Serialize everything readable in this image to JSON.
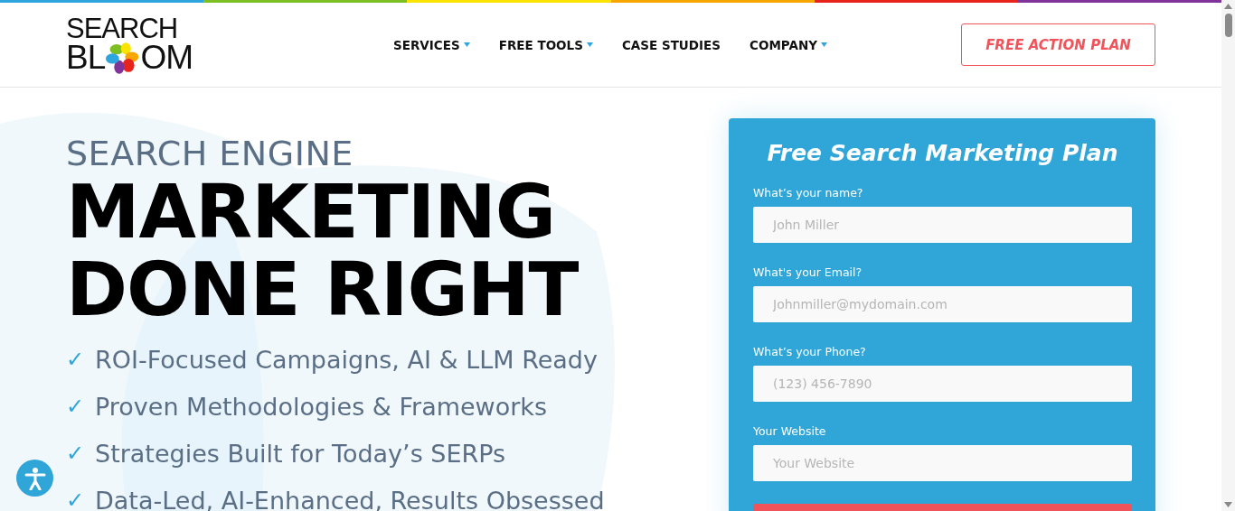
{
  "logo": {
    "top": "SEARCH",
    "bottom_left": "BL",
    "bottom_right": "OM"
  },
  "nav": [
    {
      "label": "SERVICES",
      "dropdown": true
    },
    {
      "label": "FREE TOOLS",
      "dropdown": true
    },
    {
      "label": "CASE STUDIES",
      "dropdown": false
    },
    {
      "label": "COMPANY",
      "dropdown": true
    }
  ],
  "cta_button": "FREE ACTION PLAN",
  "hero": {
    "kicker": "SEARCH ENGINE",
    "headline": [
      "MARKETING",
      "DONE RIGHT"
    ],
    "bullets": [
      {
        "mark": "✓",
        "text": "ROI-Focused Campaigns, AI & LLM Ready"
      },
      {
        "mark": "✓",
        "text": "Proven Methodologies & Frameworks"
      },
      {
        "mark": "✓",
        "text": "Strategies Built for Today’s SERPs"
      },
      {
        "mark": "✓",
        "text": "Data-Led, AI-Enhanced, Results Obsessed"
      }
    ]
  },
  "form": {
    "title": "Free Search Marketing Plan",
    "fields": [
      {
        "label": "What’s your name?",
        "placeholder": "John Miller"
      },
      {
        "label": "What's your Email?",
        "placeholder": "Johnmiller@mydomain.com"
      },
      {
        "label": "What’s your Phone?",
        "placeholder": "(123) 456-7890"
      },
      {
        "label": "Your Website",
        "placeholder": "Your Website"
      }
    ]
  }
}
